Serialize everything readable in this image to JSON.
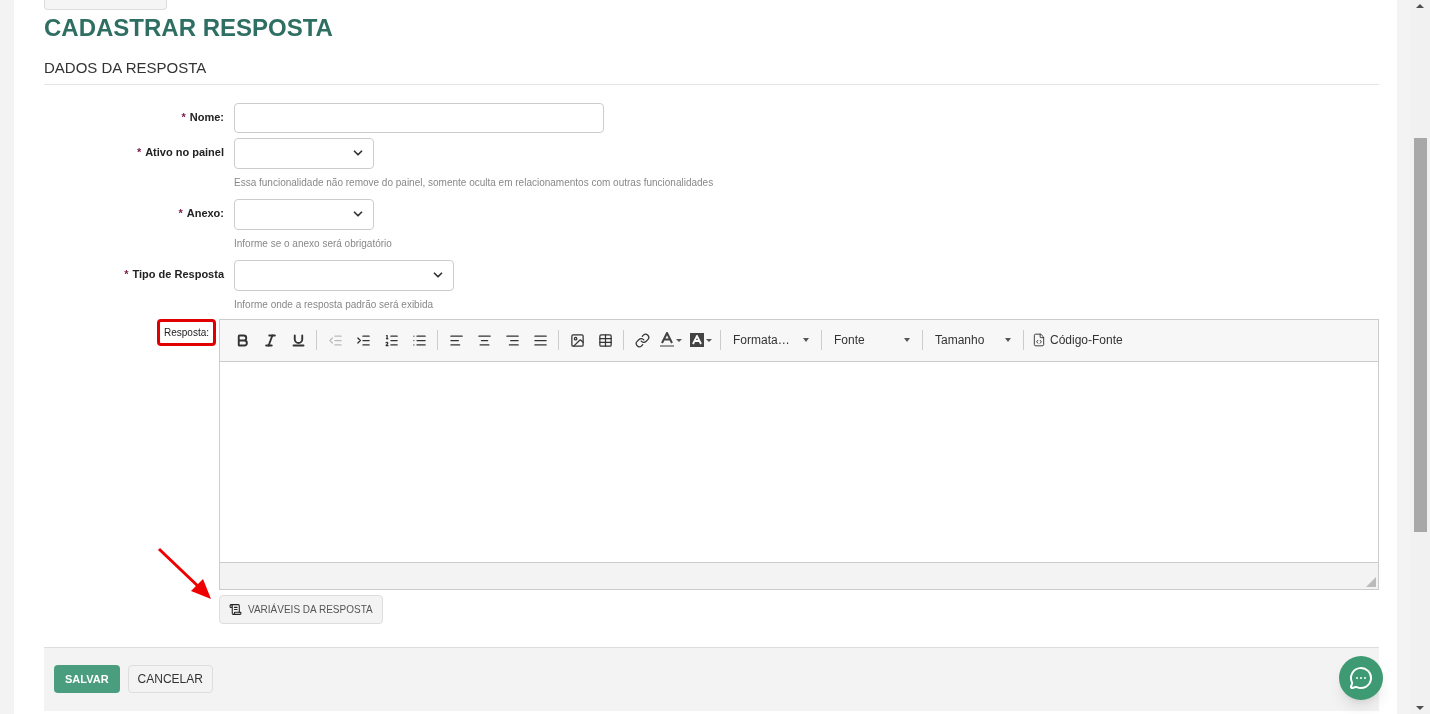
{
  "page_title": "CADASTRAR RESPOSTA",
  "section_title": "DADOS DA RESPOSTA",
  "fields": [
    {
      "kind": "text",
      "label": "Nome:",
      "marker": "*"
    },
    {
      "kind": "select",
      "label": "Ativo no painel",
      "marker": "*",
      "hint": "Essa funcionalidade não remove do painel, somente oculta em relacionamentos com outras funcionalidades"
    },
    {
      "kind": "select",
      "label": "Anexo:",
      "marker": "*",
      "hint": "Informe se o anexo será obrigatório"
    },
    {
      "kind": "select-wide",
      "label": "Tipo de Resposta",
      "marker": "*",
      "hint": "Informe onde a resposta padrão será exibida"
    }
  ],
  "editor": {
    "label": "Resposta:",
    "highlighted": true,
    "tools": [
      {
        "kind": "bold",
        "disabled": false
      },
      {
        "kind": "italic",
        "disabled": false
      },
      {
        "kind": "underline",
        "disabled": false
      },
      {
        "kind": "separator"
      },
      {
        "kind": "outdent",
        "disabled": true
      },
      {
        "kind": "indent",
        "disabled": false
      },
      {
        "kind": "ordered-list",
        "disabled": false
      },
      {
        "kind": "bullet-list",
        "disabled": false
      },
      {
        "kind": "separator"
      },
      {
        "kind": "align-left",
        "disabled": false
      },
      {
        "kind": "align-center",
        "disabled": false
      },
      {
        "kind": "align-right",
        "disabled": false
      },
      {
        "kind": "justify",
        "disabled": false
      },
      {
        "kind": "separator"
      },
      {
        "kind": "image",
        "disabled": false
      },
      {
        "kind": "table",
        "disabled": false
      },
      {
        "kind": "separator"
      },
      {
        "kind": "link",
        "disabled": false
      },
      {
        "kind": "text-color",
        "disabled": false
      },
      {
        "kind": "background-color",
        "disabled": false
      },
      {
        "kind": "separator"
      },
      {
        "kind": "dropdown",
        "label": "Formata…"
      },
      {
        "kind": "separator"
      },
      {
        "kind": "dropdown",
        "label": "Fonte"
      },
      {
        "kind": "separator"
      },
      {
        "kind": "dropdown",
        "label": "Tamanho"
      },
      {
        "kind": "separator"
      },
      {
        "kind": "source",
        "label": "Código-Fonte"
      }
    ]
  },
  "variables_button": "VARIÁVEIS DA RESPOSTA",
  "buttons": [
    {
      "kind": "primary",
      "label": "SALVAR"
    },
    {
      "kind": "secondary",
      "label": "CANCELAR"
    }
  ]
}
